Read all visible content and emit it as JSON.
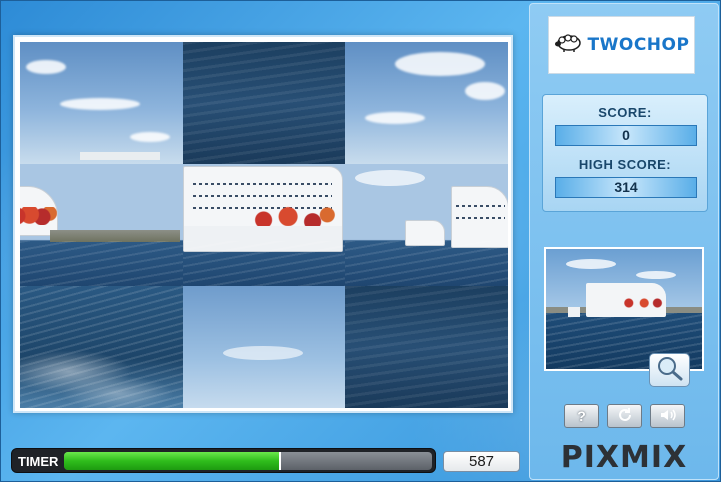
{
  "game": {
    "logo": "TWOCHOP",
    "brand": "PIXMIX",
    "logo_icon": "sheep-icon"
  },
  "score_panel": {
    "score_label": "SCORE:",
    "score_value": "0",
    "high_score_label": "HIGH SCORE:",
    "high_score_value": "314"
  },
  "timer": {
    "label": "TIMER",
    "progress": 0.59,
    "count": "587"
  },
  "puzzle": {
    "grid": "3x3",
    "tiles": [
      "sky-left",
      "water-dark",
      "sky-right",
      "ship-left-sea",
      "ship-center",
      "ships-right-sea",
      "wake-foam",
      "sky-light",
      "sea-right"
    ]
  },
  "controls": {
    "zoom_icon": "magnifier-icon",
    "help_label": "?",
    "restart_icon": "restart-icon",
    "sound_icon": "speaker-icon"
  },
  "colors": {
    "timer_fill": "#2fbd1c",
    "logo_blue": "#1976c9",
    "panel_blue": "#6db8ec"
  }
}
